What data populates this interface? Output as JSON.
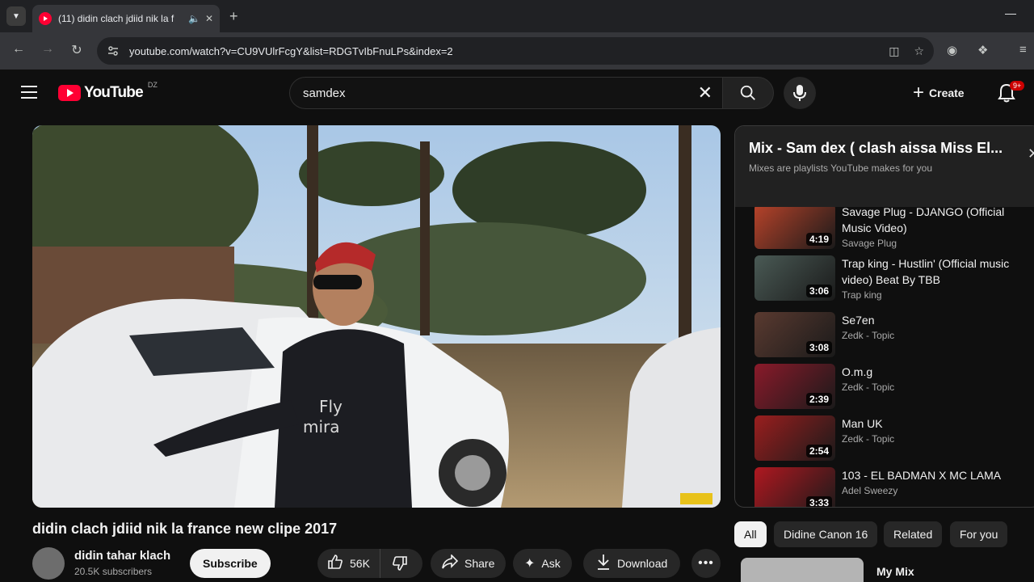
{
  "browser": {
    "tab_title": "(11) didin clach jdiid nik la f",
    "url": "youtube.com/watch?v=CU9VUlrFcgY&list=RDGTvIbFnuLPs&index=2"
  },
  "masthead": {
    "logo_text": "YouTube",
    "country_code": "DZ",
    "search_value": "samdex",
    "create_label": "Create",
    "notification_count": "9+"
  },
  "video": {
    "title": "didin clach jdiid nik la france new clipe 2017",
    "channel": "didin tahar klach",
    "subscribers": "20.5K subscribers",
    "subscribe_label": "Subscribe",
    "likes": "56K",
    "share_label": "Share",
    "ask_label": "Ask",
    "download_label": "Download"
  },
  "playlist": {
    "title": "Mix - Sam dex ( clash aissa Miss El...",
    "subtitle": "Mixes are playlists YouTube makes for you",
    "items": [
      {
        "title": "Savage Plug - DJANGO (Official Music Video)",
        "channel": "Savage Plug",
        "duration": "4:19",
        "color": "#b8432a"
      },
      {
        "title": "Trap king - Hustlin' (Official music video) Beat By TBB",
        "channel": "Trap king",
        "duration": "3:06",
        "color": "#4a5a55"
      },
      {
        "title": "Se7en",
        "channel": "Zedk - Topic",
        "duration": "3:08",
        "color": "#5a3a30"
      },
      {
        "title": "O.m.g",
        "channel": "Zedk - Topic",
        "duration": "2:39",
        "color": "#8a1a2a"
      },
      {
        "title": "Man UK",
        "channel": "Zedk - Topic",
        "duration": "2:54",
        "color": "#9a1e1e"
      },
      {
        "title": "103 - EL BADMAN X MC LAMA",
        "channel": "Adel Sweezy",
        "duration": "3:33",
        "color": "#b01820"
      }
    ]
  },
  "chips": [
    "All",
    "Didine Canon 16",
    "Related",
    "For you"
  ],
  "recommendation": {
    "title": "My Mix"
  }
}
